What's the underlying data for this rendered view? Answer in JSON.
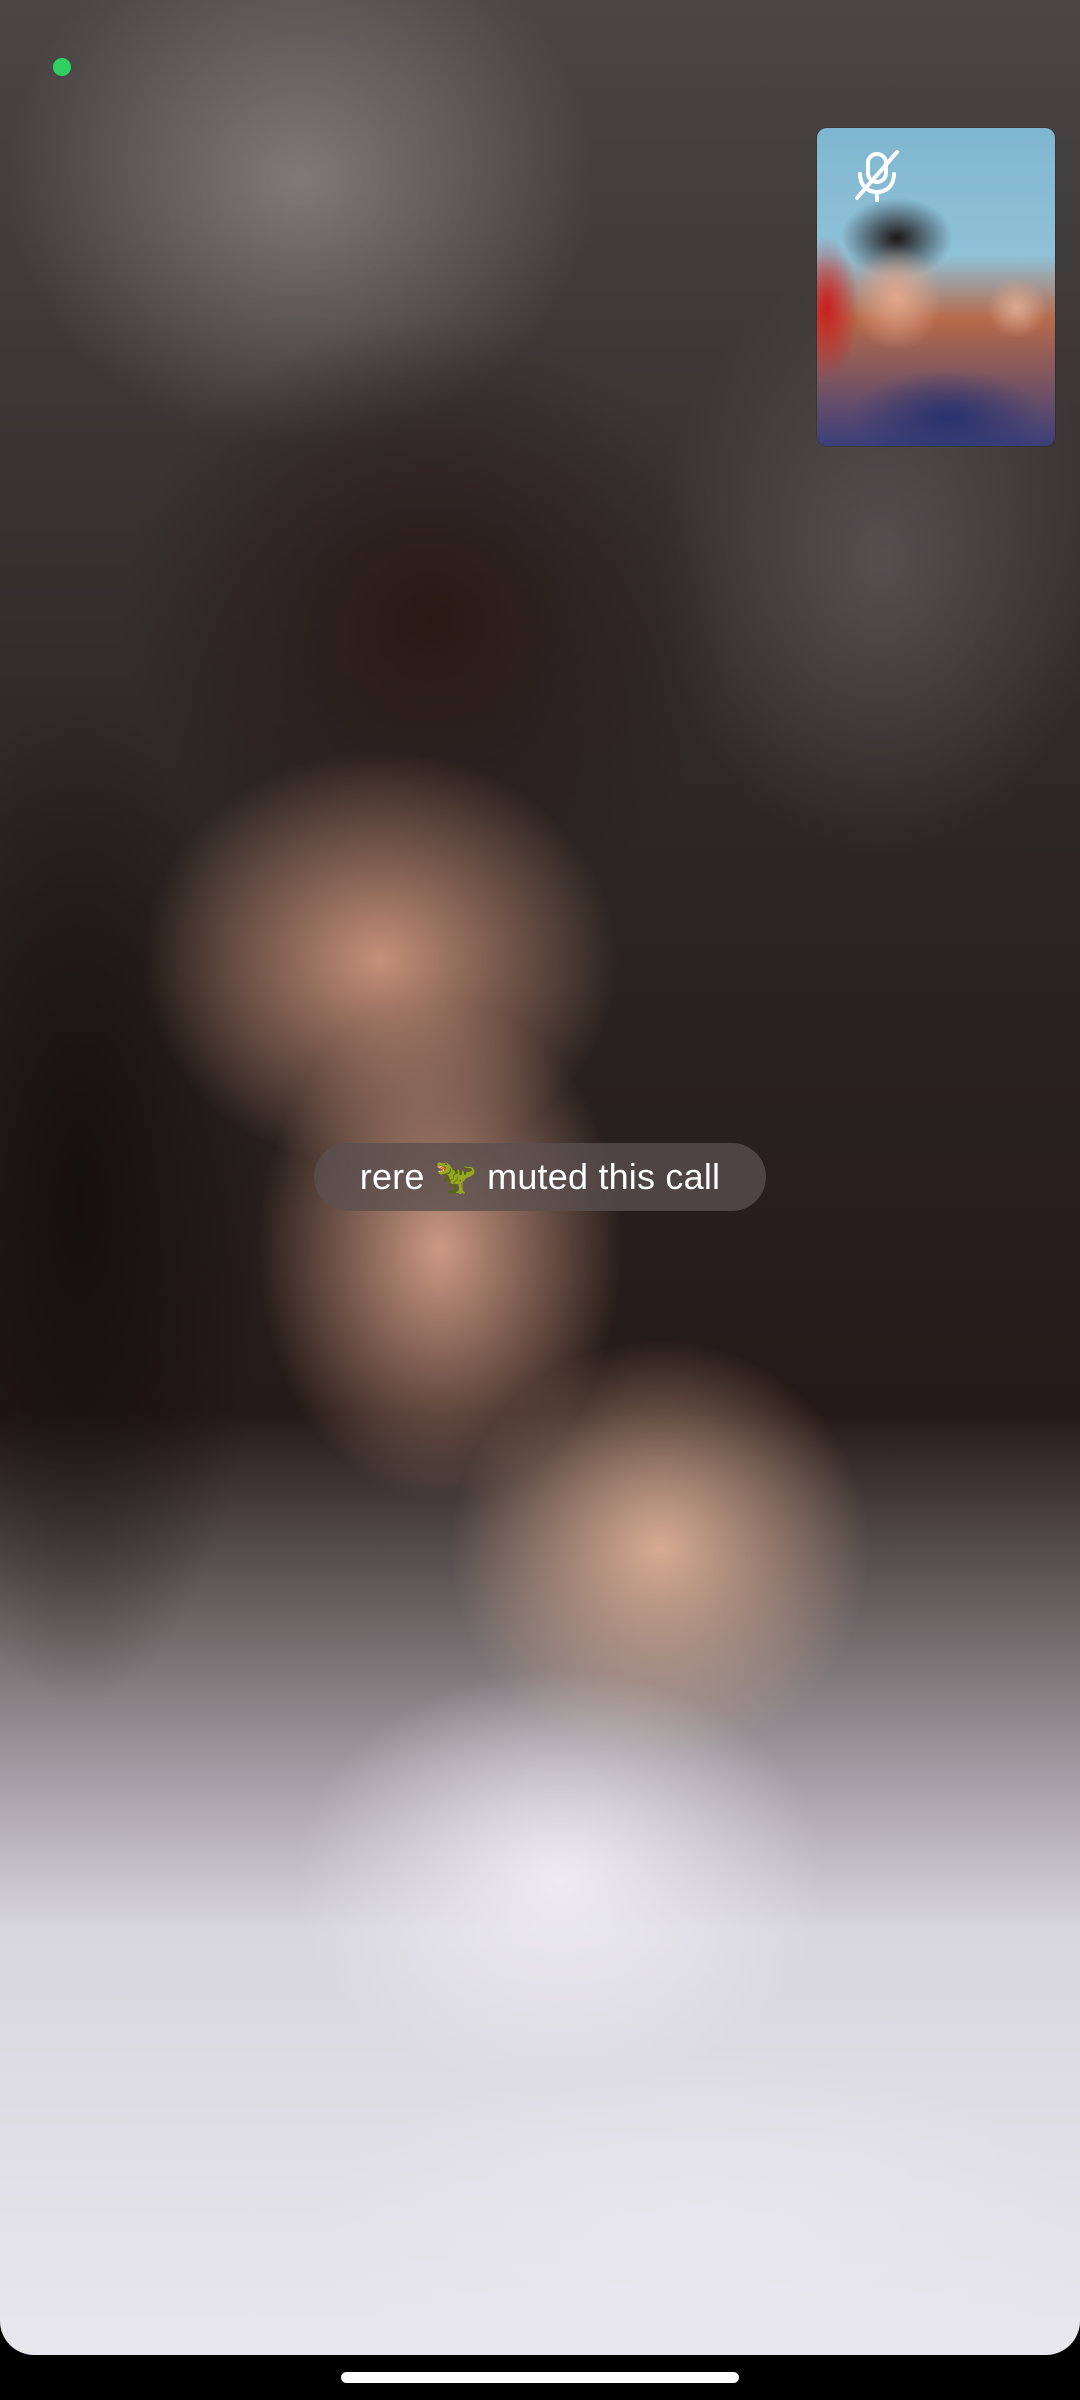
{
  "call": {
    "status_dot_color": "#2fd05f",
    "self_view": {
      "mic_icon": "mic-off-icon"
    },
    "toast": {
      "user_name": "rere",
      "emoji": "🦖",
      "message": "muted this call"
    }
  }
}
